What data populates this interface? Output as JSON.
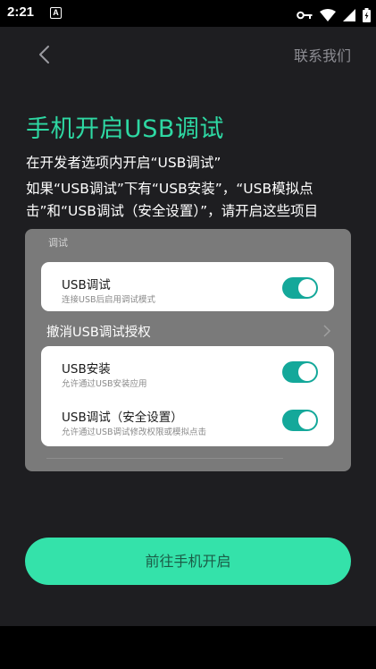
{
  "status_bar": {
    "time": "2:21",
    "notification_icon_letter": "A",
    "icons": [
      "key-icon",
      "wifi-icon",
      "signal-icon",
      "battery-icon"
    ]
  },
  "header": {
    "back_icon": "chevron-left-icon",
    "contact_label": "联系我们"
  },
  "main": {
    "title": "手机开启USB调试",
    "subtitle": "在开发者选项内开启“USB调试”",
    "description": "如果“USB调试”下有“USB安装”，“USB模拟点击”和“USB调试（安全设置）”，请开启这些项目"
  },
  "illustration": {
    "section_label": "调试",
    "card1": {
      "title": "USB调试",
      "subtitle": "连接USB后启用调试模式",
      "enabled": true
    },
    "revoke_label": "撤消USB调试授权",
    "card2": {
      "items": [
        {
          "title": "USB安装",
          "subtitle": "允许通过USB安装应用",
          "enabled": true
        },
        {
          "title": "USB调试（安全设置）",
          "subtitle": "允许通过USB调试修改权限或模拟点击",
          "enabled": true
        }
      ]
    }
  },
  "primary_button": {
    "label": "前往手机开启"
  },
  "colors": {
    "accent_title": "#2ed8a3",
    "button_bg": "#34e2aa",
    "toggle_on": "#14a89a",
    "background": "#1e1e21"
  }
}
